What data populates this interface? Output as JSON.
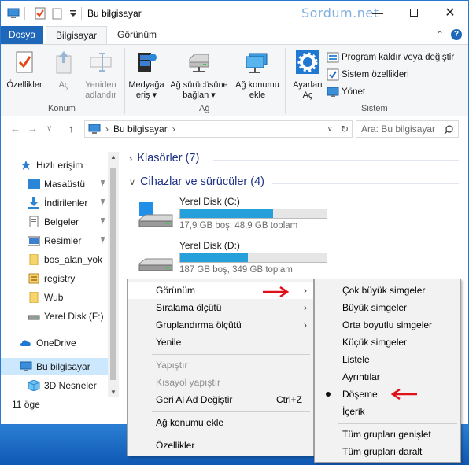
{
  "title": "Bu bilgisayar",
  "watermark": "Sordum.net",
  "tabs": {
    "file": "Dosya",
    "computer": "Bilgisayar",
    "view": "Görünüm"
  },
  "ribbon": {
    "location_group": "Konum",
    "network_group": "Ağ",
    "system_group": "Sistem",
    "properties": "Özellikler",
    "open": "Aç",
    "rename_1": "Yeniden",
    "rename_2": "adlandır",
    "media_1": "Medyağa",
    "media_2": "eriş",
    "map_drive_1": "Ağ sürücüsüne",
    "map_drive_2": "bağlan",
    "add_location_1": "Ağ konumu",
    "add_location_2": "ekle",
    "settings_1": "Ayarları",
    "settings_2": "Aç",
    "uninstall": "Program kaldır veya değiştir",
    "system_props": "Sistem özellikleri",
    "manage": "Yönet"
  },
  "address": {
    "path": "Bu bilgisayar",
    "search_placeholder": "Ara: Bu bilgisayar"
  },
  "nav": {
    "quick_access": "Hızlı erişim",
    "items": [
      "Masaüstü",
      "İndirilenler",
      "Belgeler",
      "Resimler",
      "bos_alan_yok",
      "registry",
      "Wub",
      "Yerel Disk (F:)"
    ],
    "onedrive": "OneDrive",
    "this_pc": "Bu bilgisayar",
    "objects3d": "3D Nesneler"
  },
  "status": "11 öge",
  "content": {
    "folders_header": "Klasörler (7)",
    "devices_header": "Cihazlar ve sürücüler (4)",
    "drives": [
      {
        "name": "Yerel Disk (C:)",
        "info": "17,9 GB boş, 48,9 GB toplam",
        "used_fraction": 0.634
      },
      {
        "name": "Yerel Disk (D:)",
        "info": "187 GB boş, 349 GB toplam",
        "used_fraction": 0.464
      }
    ]
  },
  "context_menu": {
    "view": "Görünüm",
    "sort": "Sıralama ölçütü",
    "group": "Gruplandırma ölçütü",
    "refresh": "Yenile",
    "paste": "Yapıştır",
    "paste_shortcut": "Kısayol yapıştır",
    "undo": "Geri Al Ad Değiştir",
    "undo_shortcut": "Ctrl+Z",
    "add_network": "Ağ konumu ekle",
    "properties": "Özellikler"
  },
  "view_submenu": {
    "items": [
      "Çok büyük simgeler",
      "Büyük simgeler",
      "Orta boyutlu simgeler",
      "Küçük simgeler",
      "Listele",
      "Ayrıntılar",
      "Döşeme",
      "İçerik"
    ],
    "expand_groups": "Tüm grupları genişlet",
    "collapse_groups": "Tüm grupları daralt"
  },
  "colors": {
    "accent": "#1f67b8",
    "progress": "#26a0da",
    "arrow": "#e0101a",
    "header": "#1e3287"
  }
}
